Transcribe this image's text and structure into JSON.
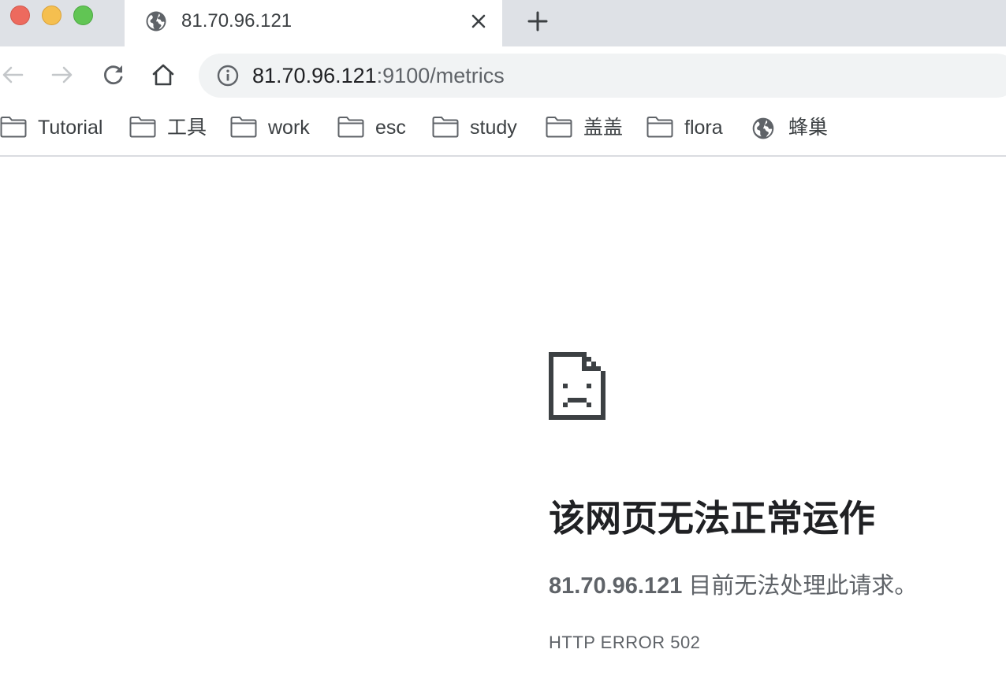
{
  "window": {
    "controls": [
      "close",
      "minimize",
      "maximize"
    ]
  },
  "tab": {
    "title": "81.70.96.121",
    "icon": "globe-icon"
  },
  "toolbar": {
    "url_host": "81.70.96.121",
    "url_path": ":9100/metrics"
  },
  "bookmarks": [
    {
      "label": "Tutorial",
      "icon": "folder-icon"
    },
    {
      "label": "工具",
      "icon": "folder-icon"
    },
    {
      "label": "work",
      "icon": "folder-icon"
    },
    {
      "label": "esc",
      "icon": "folder-icon"
    },
    {
      "label": "study",
      "icon": "folder-icon"
    },
    {
      "label": "盖盖",
      "icon": "folder-icon"
    },
    {
      "label": "flora",
      "icon": "folder-icon"
    },
    {
      "label": "蜂巢",
      "icon": "globe-icon"
    }
  ],
  "error": {
    "title": "该网页无法正常运作",
    "host": "81.70.96.121",
    "message": " 目前无法处理此请求。",
    "code": "HTTP ERROR 502"
  },
  "colors": {
    "tabstrip_bg": "#dee1e6",
    "omnibox_bg": "#f1f3f4",
    "close": "#ed6a5e",
    "minimize": "#f5bf4f",
    "maximize": "#61c554",
    "text_primary": "#202124",
    "text_secondary": "#5f6368"
  }
}
